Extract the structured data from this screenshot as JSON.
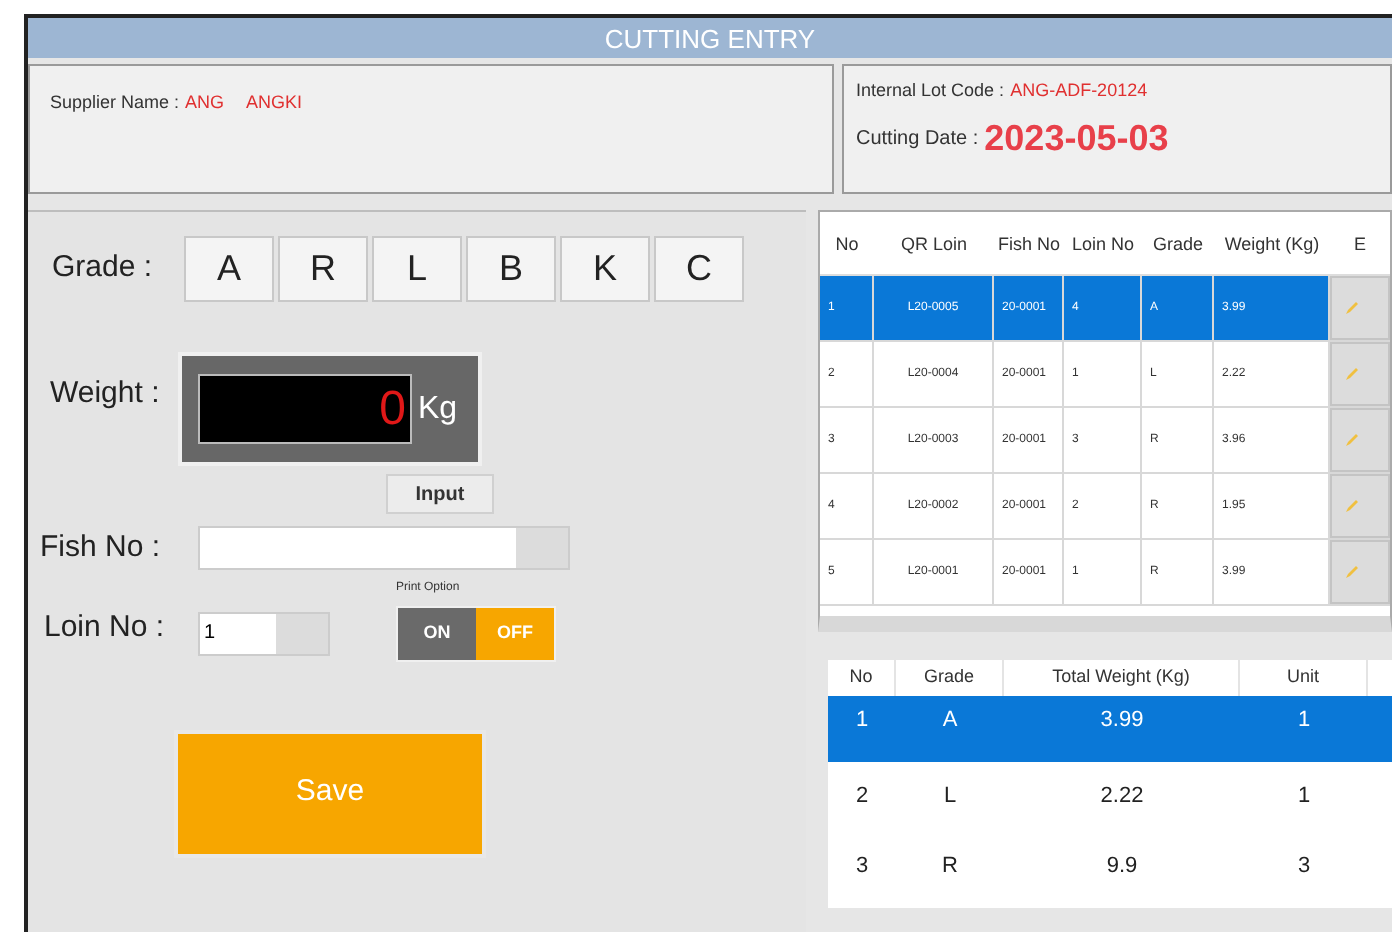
{
  "window": {
    "title": "CUTTING ENTRY"
  },
  "supplier": {
    "label": "Supplier Name :",
    "code": "ANG",
    "name": "ANGKI"
  },
  "lot": {
    "label": "Internal Lot Code :",
    "value": "ANG-ADF-20124"
  },
  "cutting_date": {
    "label": "Cutting Date :",
    "value": "2023-05-03"
  },
  "grade": {
    "label": "Grade :",
    "options": [
      {
        "label": "A",
        "selected": false
      },
      {
        "label": "R",
        "selected": false
      },
      {
        "label": "L",
        "selected": false
      },
      {
        "label": "B",
        "selected": false
      },
      {
        "label": "K",
        "selected": false
      },
      {
        "label": "C",
        "selected": false
      }
    ]
  },
  "weight": {
    "label": "Weight :",
    "value": "0",
    "unit": "Kg"
  },
  "input_button": "Input",
  "fish_no": {
    "label": "Fish No :"
  },
  "loin_no": {
    "label": "Loin No :",
    "value": "1"
  },
  "print_option": {
    "label": "Print Option",
    "options": [
      {
        "label": "ON",
        "selected": false
      },
      {
        "label": "OFF",
        "selected": true
      }
    ]
  },
  "save_button": "Save",
  "table": {
    "columns": [
      "No",
      "QR Loin",
      "Fish No",
      "Loin No",
      "Grade",
      "Weight (Kg)",
      "E"
    ],
    "rows": [
      {
        "no": "1",
        "qr_loin": "L20-0005",
        "fish_no": "20-0001",
        "loin_no": "4",
        "grade": "A",
        "weight": "3.99",
        "selected": true
      },
      {
        "no": "2",
        "qr_loin": "L20-0004",
        "fish_no": "20-0001",
        "loin_no": "1",
        "grade": "L",
        "weight": "2.22",
        "selected": false
      },
      {
        "no": "3",
        "qr_loin": "L20-0003",
        "fish_no": "20-0001",
        "loin_no": "3",
        "grade": "R",
        "weight": "3.96",
        "selected": false
      },
      {
        "no": "4",
        "qr_loin": "L20-0002",
        "fish_no": "20-0001",
        "loin_no": "2",
        "grade": "R",
        "weight": "1.95",
        "selected": false
      },
      {
        "no": "5",
        "qr_loin": "L20-0001",
        "fish_no": "20-0001",
        "loin_no": "1",
        "grade": "R",
        "weight": "3.99",
        "selected": false
      }
    ]
  },
  "summary": {
    "columns": [
      "No",
      "Grade",
      "Total Weight (Kg)",
      "Unit"
    ],
    "rows": [
      {
        "no": "1",
        "grade": "A",
        "total_weight": "3.99",
        "unit": "1",
        "selected": true
      },
      {
        "no": "2",
        "grade": "L",
        "total_weight": "2.22",
        "unit": "1",
        "selected": false
      },
      {
        "no": "3",
        "grade": "R",
        "total_weight": "9.9",
        "unit": "3",
        "selected": false
      }
    ]
  }
}
